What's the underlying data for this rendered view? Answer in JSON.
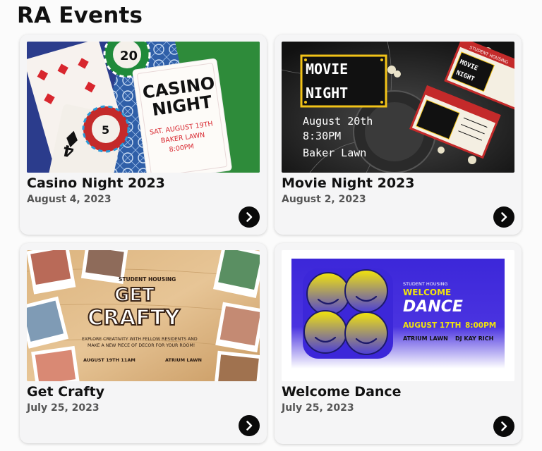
{
  "page": {
    "title": "RA Events"
  },
  "events": [
    {
      "title": "Casino Night 2023",
      "date": "August 4, 2023",
      "poster": {
        "headline_1": "CASINO",
        "headline_2": "NIGHT",
        "line_1": "SAT. AUGUST 19TH",
        "line_2": "BAKER LAWN",
        "line_3": "8:00PM",
        "chip_value": "20"
      }
    },
    {
      "title": "Movie Night 2023",
      "date": "August 2, 2023",
      "poster": {
        "headline_1": "MOVIE",
        "headline_2": "NIGHT",
        "line_1": "August 20th",
        "line_2": "8:30PM",
        "line_3": "Baker Lawn",
        "ticket_header": "STUDENT HOUSING",
        "ticket_title_1": "MOVIE",
        "ticket_title_2": "NIGHT"
      }
    },
    {
      "title": "Get Crafty",
      "date": "July 25, 2023",
      "poster": {
        "kicker": "STUDENT HOUSING",
        "headline_1": "GET",
        "headline_2": "CRAFTY",
        "body_1": "EXPLORE CREATIVITY WITH FELLOW RESIDENTS AND",
        "body_2": "MAKE A NEW PIECE OF DECOR FOR YOUR ROOM!",
        "footer_left": "AUGUST 19TH  11AM",
        "footer_right": "ATRIUM LAWN"
      }
    },
    {
      "title": "Welcome Dance",
      "date": "July 25, 2023",
      "poster": {
        "kicker": "STUDENT HOUSING",
        "headline_1": "WELCOME",
        "headline_2": "DANCE",
        "line_1": "AUGUST 17TH",
        "line_2": "8:00PM",
        "line_3": "ATRIUM LAWN",
        "line_4": "DJ KAY RICH"
      }
    }
  ],
  "icons": {
    "open": "chevron-right-icon"
  },
  "colors": {
    "go_button": "#0a0a0a",
    "card_bg": "#f5f5f6",
    "dance_blue": "#3c27d9",
    "dance_yellow": "#f2e40c"
  }
}
